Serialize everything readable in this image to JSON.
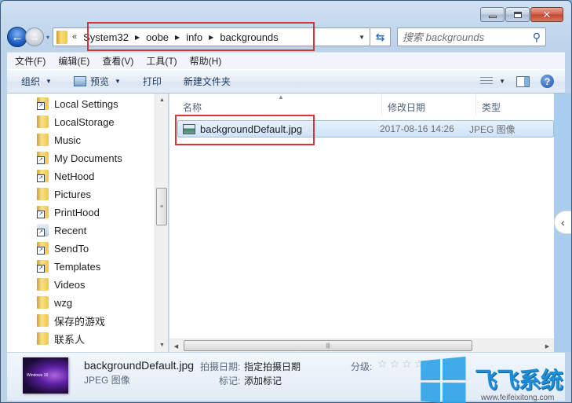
{
  "window": {
    "controls": {
      "minimize": "minimize",
      "maximize": "maximize",
      "close": "close"
    }
  },
  "nav": {
    "back_icon": "back-arrow-icon",
    "forward_icon": "forward-arrow-icon",
    "history_dropdown": "▾",
    "overflow": "«",
    "breadcrumbs": [
      "System32",
      "oobe",
      "info",
      "backgrounds"
    ],
    "refresh_icon": "refresh-icon",
    "search_placeholder": "搜索 backgrounds"
  },
  "menubar": {
    "items": [
      "文件(F)",
      "编辑(E)",
      "查看(V)",
      "工具(T)",
      "帮助(H)"
    ]
  },
  "commandbar": {
    "organize": "组织",
    "preview": "预览",
    "print": "打印",
    "new_folder": "新建文件夹"
  },
  "nav_pane": {
    "items": [
      {
        "label": "Local Settings",
        "icon": "shortcut-folder-icon"
      },
      {
        "label": "LocalStorage",
        "icon": "folder-icon"
      },
      {
        "label": "Music",
        "icon": "folder-icon"
      },
      {
        "label": "My Documents",
        "icon": "shortcut-folder-icon"
      },
      {
        "label": "NetHood",
        "icon": "shortcut-folder-icon"
      },
      {
        "label": "Pictures",
        "icon": "folder-icon"
      },
      {
        "label": "PrintHood",
        "icon": "shortcut-folder-icon"
      },
      {
        "label": "Recent",
        "icon": "recent-shortcut-icon"
      },
      {
        "label": "SendTo",
        "icon": "shortcut-folder-icon"
      },
      {
        "label": "Templates",
        "icon": "shortcut-folder-icon"
      },
      {
        "label": "Videos",
        "icon": "folder-icon"
      },
      {
        "label": "wzg",
        "icon": "folder-icon"
      },
      {
        "label": "保存的游戏",
        "icon": "saved-games-icon"
      },
      {
        "label": "联系人",
        "icon": "contacts-icon"
      }
    ]
  },
  "file_list": {
    "columns": [
      "名称",
      "修改日期",
      "类型"
    ],
    "rows": [
      {
        "name": "backgroundDefault.jpg",
        "modified": "2017-08-16 14:26",
        "type": "JPEG 图像",
        "selected": true
      }
    ]
  },
  "details": {
    "file_name": "backgroundDefault.jpg",
    "file_type": "JPEG 图像",
    "date_taken_label": "拍摄日期:",
    "date_taken_value": "指定拍摄日期",
    "tags_label": "标记:",
    "tags_value": "添加标记",
    "rating_label": "分级:",
    "rating": 0,
    "rating_max": 5,
    "thumbnail_caption": "Windows 10"
  },
  "watermark": {
    "brand": "飞飞系统",
    "url": "www.feifeixitong.com"
  },
  "colors": {
    "highlight_box": "#d9343a",
    "selection": "#cfe3f9",
    "frame": "#bcd3ea"
  }
}
